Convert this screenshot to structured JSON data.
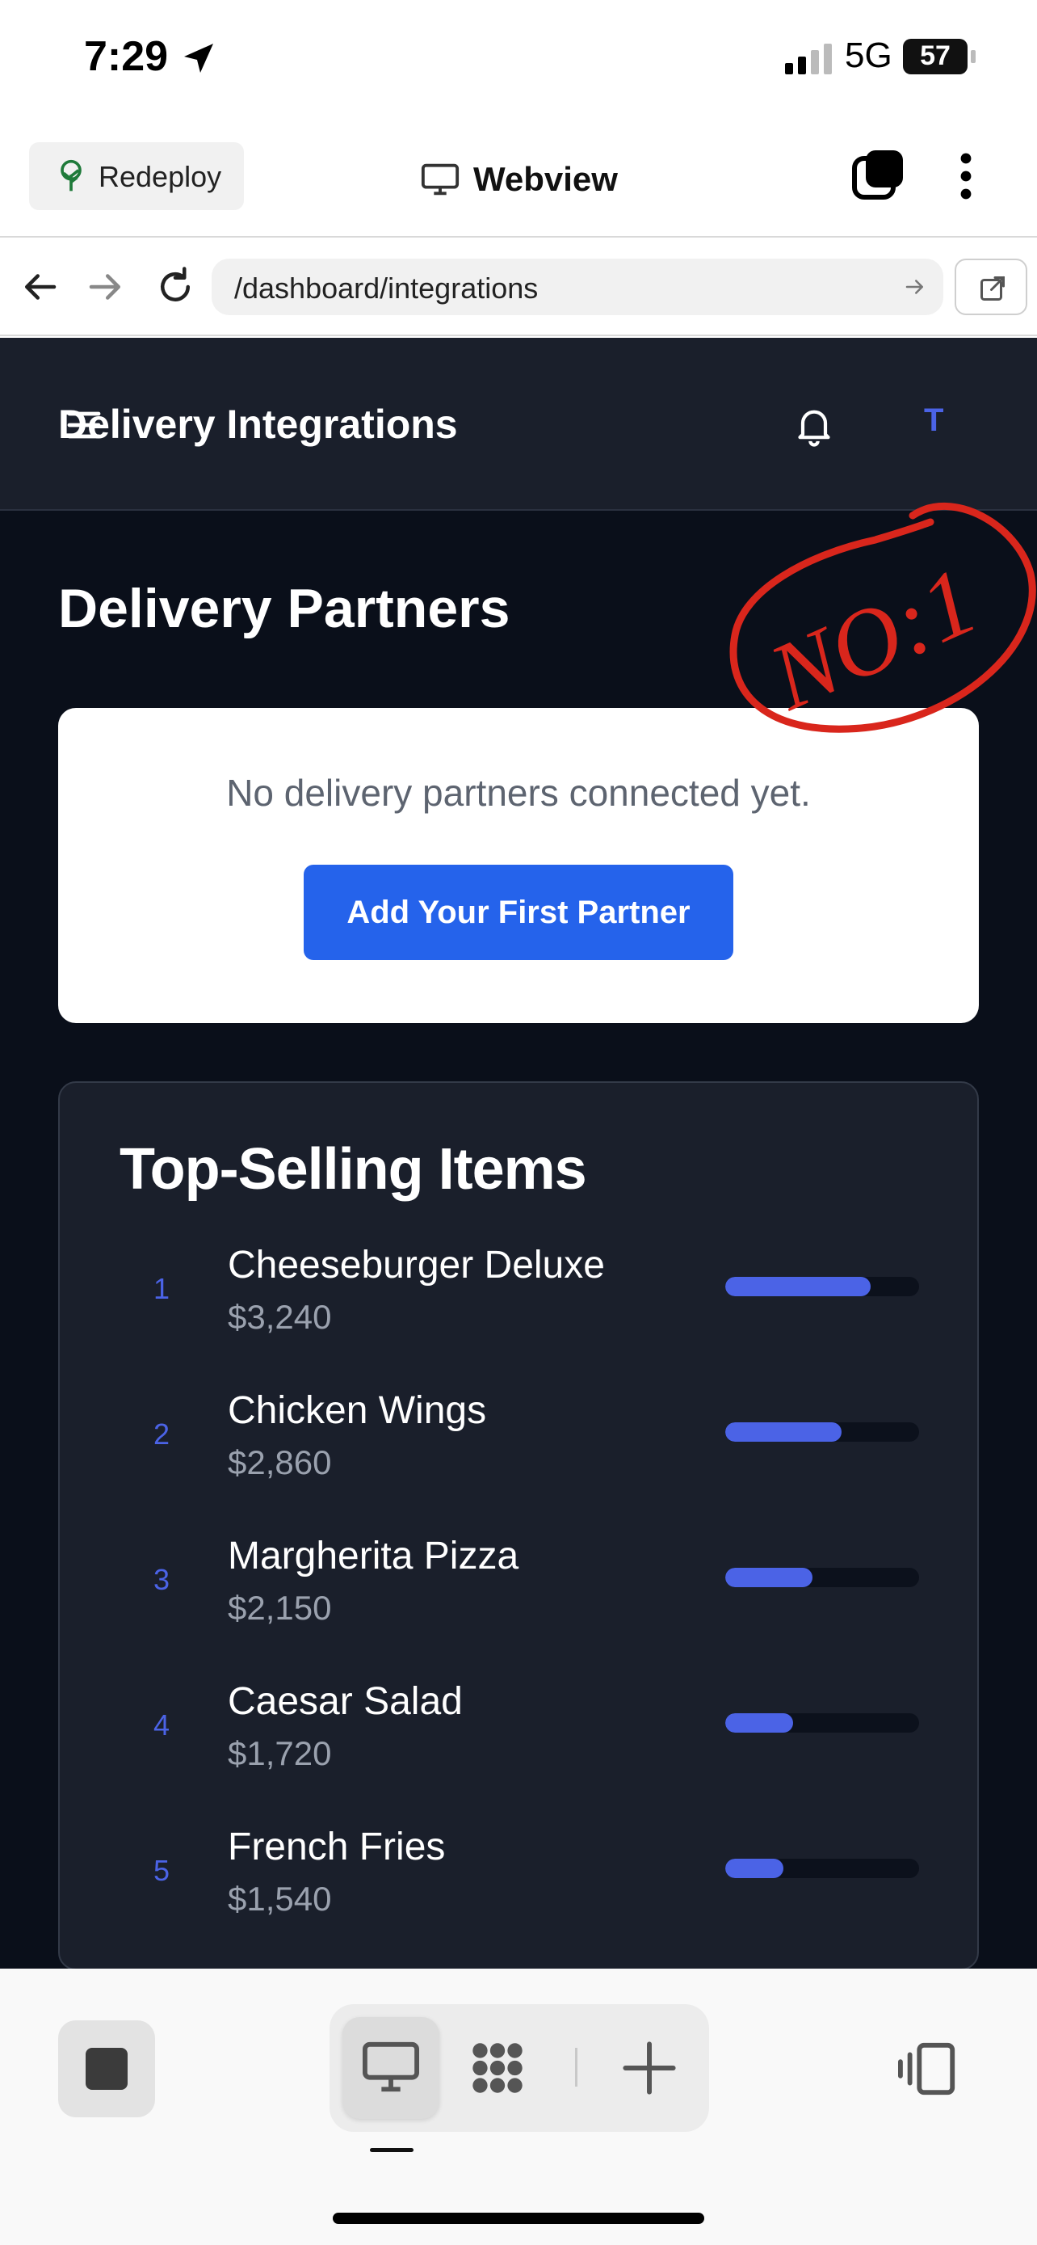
{
  "status_bar": {
    "time": "7:29",
    "network": "5G",
    "battery": "57"
  },
  "app_header": {
    "redeploy_label": "Redeploy",
    "title": "Webview"
  },
  "url_bar": {
    "url": "/dashboard/integrations"
  },
  "site": {
    "header_title": "Delivery Integrations",
    "avatar_initial": "T",
    "section_title": "Delivery Partners",
    "empty_state": {
      "message": "No delivery partners connected yet.",
      "button_label": "Add Your First Partner"
    },
    "annotation_text": "NO:1",
    "top_selling": {
      "title": "Top-Selling Items",
      "items": [
        {
          "rank": "1",
          "name": "Cheeseburger Deluxe",
          "value": "$3,240",
          "share": 0.75
        },
        {
          "rank": "2",
          "name": "Chicken Wings",
          "value": "$2,860",
          "share": 0.6
        },
        {
          "rank": "3",
          "name": "Margherita Pizza",
          "value": "$2,150",
          "share": 0.45
        },
        {
          "rank": "4",
          "name": "Caesar Salad",
          "value": "$1,720",
          "share": 0.35
        },
        {
          "rank": "5",
          "name": "French Fries",
          "value": "$1,540",
          "share": 0.3
        }
      ]
    }
  },
  "colors": {
    "accent": "#4b63e6",
    "primary_button": "#2563eb",
    "annotation": "#d9261c"
  }
}
